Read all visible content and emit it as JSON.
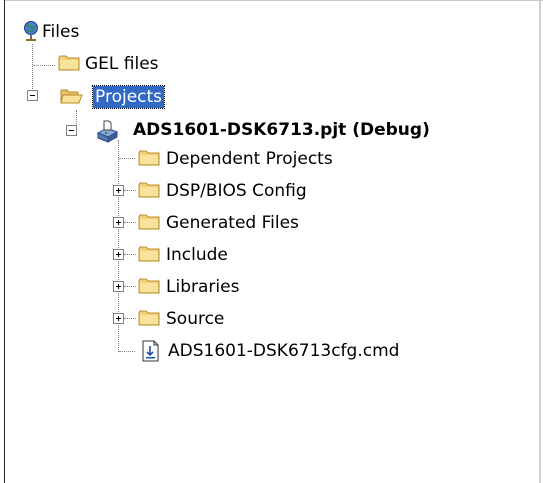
{
  "tree": {
    "root": {
      "label": "Files",
      "icon": "globe-pin-icon"
    },
    "gel_files": {
      "label": "GEL files",
      "icon": "folder-icon"
    },
    "projects": {
      "label": "Projects",
      "icon": "open-folder-icon",
      "selected": true,
      "expanded": true
    },
    "project": {
      "label": "ADS1601-DSK6713.pjt (Debug)",
      "icon": "project-file-icon",
      "expanded": true
    },
    "children": [
      {
        "label": "Dependent Projects",
        "icon": "folder-icon",
        "expander": "none"
      },
      {
        "label": "DSP/BIOS Config",
        "icon": "folder-icon",
        "expander": "plus"
      },
      {
        "label": "Generated Files",
        "icon": "folder-icon",
        "expander": "plus"
      },
      {
        "label": "Include",
        "icon": "folder-icon",
        "expander": "plus"
      },
      {
        "label": "Libraries",
        "icon": "folder-icon",
        "expander": "plus"
      },
      {
        "label": "Source",
        "icon": "folder-icon",
        "expander": "plus"
      },
      {
        "label": "ADS1601-DSK6713cfg.cmd",
        "icon": "cmd-file-icon",
        "expander": "none"
      }
    ]
  },
  "colors": {
    "selection": "#316ac5",
    "folder": "#f3d27a",
    "folder_edge": "#b58b2a",
    "tree_line": "#808080"
  }
}
